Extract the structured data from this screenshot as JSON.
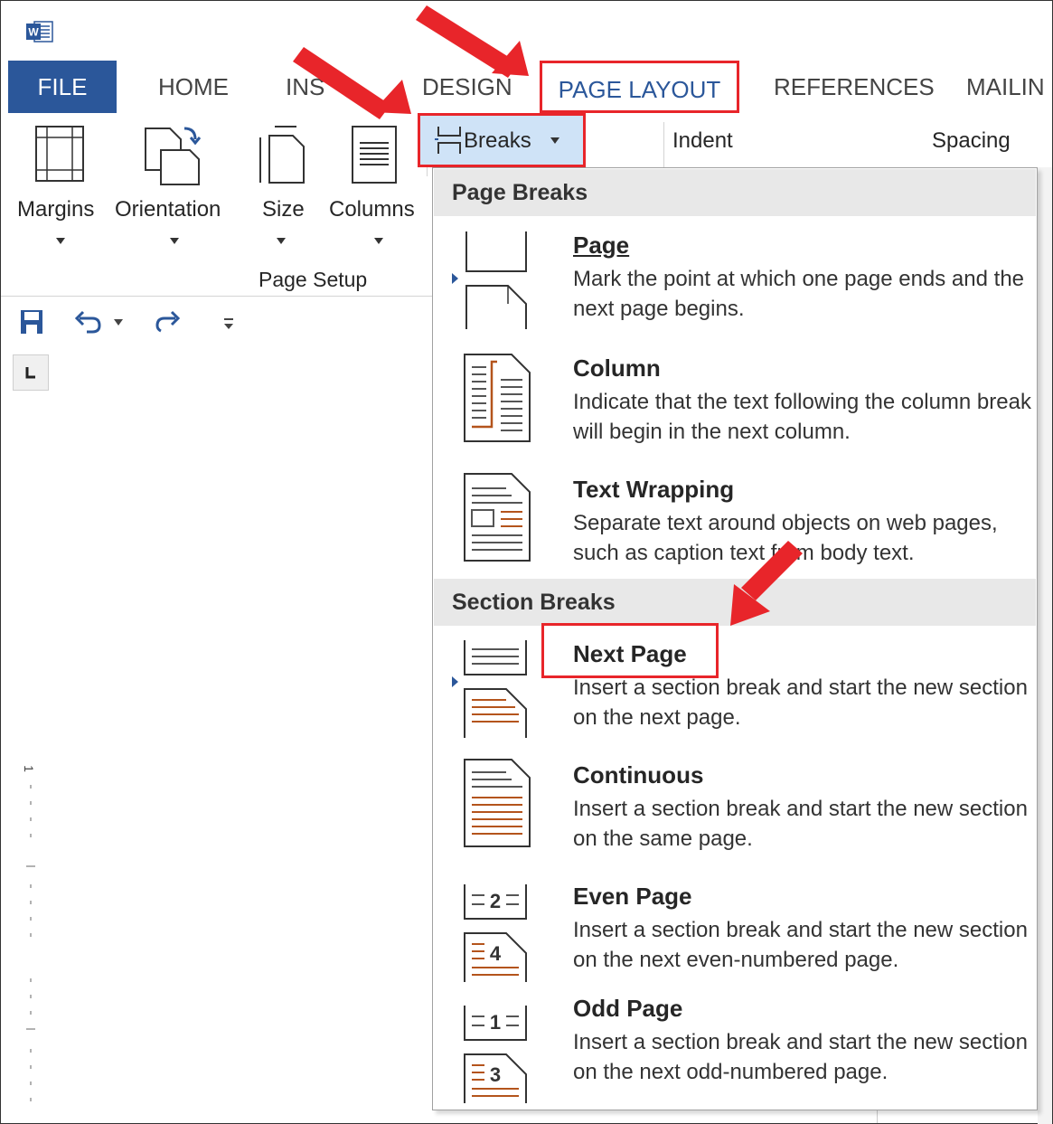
{
  "app": {
    "logo": "word-icon",
    "brand_color": "#2b579a"
  },
  "tabs": [
    {
      "label": "FILE"
    },
    {
      "label": "HOME"
    },
    {
      "label": "INS"
    },
    {
      "label": "DESIGN"
    },
    {
      "label": "PAGE LAYOUT"
    },
    {
      "label": "REFERENCES"
    },
    {
      "label": "MAILIN"
    }
  ],
  "ribbon": {
    "margins": "Margins",
    "orientation": "Orientation",
    "size": "Size",
    "columns": "Columns",
    "group_label": "Page Setup",
    "breaks": "Breaks",
    "indent": "Indent",
    "spacing": "Spacing"
  },
  "menu": {
    "page_breaks_header": "Page Breaks",
    "section_breaks_header": "Section Breaks",
    "items": [
      {
        "title": "Page",
        "desc": "Mark the point at which one page ends and the next page begins."
      },
      {
        "title": "Column",
        "desc": "Indicate that the text following the column break will begin in the next column."
      },
      {
        "title": "Text Wrapping",
        "desc": "Separate text around objects on web pages, such as caption text from body text."
      },
      {
        "title": "Next Page",
        "desc": "Insert a section break and start the new section on the next page."
      },
      {
        "title": "Continuous",
        "desc": "Insert a section break and start the new section on the same page."
      },
      {
        "title": "Even Page",
        "desc": "Insert a section break and start the new section on the next even-numbered page."
      },
      {
        "title": "Odd Page",
        "desc": "Insert a section break and start the new section on the next odd-numbered page."
      }
    ],
    "even_icon_top": "2",
    "even_icon_bottom": "4",
    "odd_icon_top": "1",
    "odd_icon_bottom": "3"
  },
  "ruler": {
    "number": "1"
  },
  "colors": {
    "highlight": "#e8252a",
    "accent_brown": "#b4541c"
  }
}
